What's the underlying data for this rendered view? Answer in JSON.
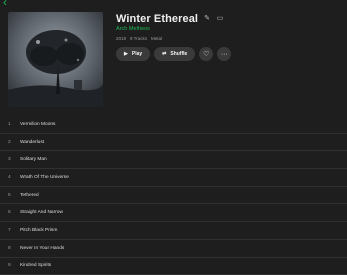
{
  "album": {
    "title": "Winter Ethereal",
    "artist": "Arch Metheos",
    "year": "2019",
    "track_count": "9 Tracks",
    "genre": "Metal",
    "icons": {
      "back": "back-arrow-icon",
      "edit": "pencil-icon",
      "display": "monitor-icon"
    }
  },
  "controls": {
    "play_label": "Play",
    "shuffle_label": "Shuffle",
    "like_icon": "heart-icon",
    "more_icon": "more-icon"
  },
  "colors": {
    "accent": "#1db954",
    "background": "#1e1e1e",
    "button": "#3a3a3a"
  },
  "tracks": [
    {
      "number": "1",
      "name": "Vermilion Moons"
    },
    {
      "number": "2",
      "name": "Wanderlust"
    },
    {
      "number": "3",
      "name": "Solitary Man"
    },
    {
      "number": "4",
      "name": "Wrath Of The Universe"
    },
    {
      "number": "5",
      "name": "Tethered"
    },
    {
      "number": "6",
      "name": "Straight And Narrow"
    },
    {
      "number": "7",
      "name": "Pitch Black Prism"
    },
    {
      "number": "8",
      "name": "Never In Your Hands"
    },
    {
      "number": "9",
      "name": "Kindred Spirits"
    }
  ]
}
